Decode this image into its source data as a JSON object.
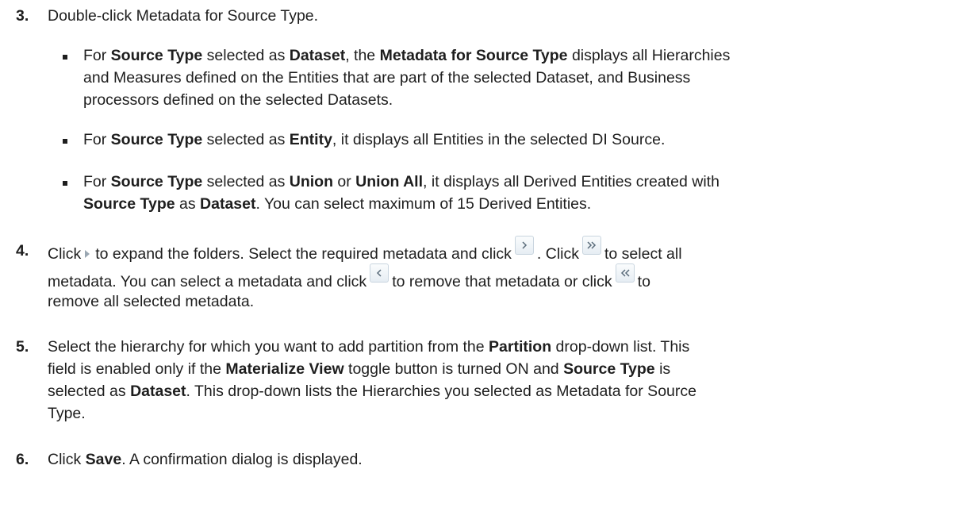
{
  "steps": [
    {
      "number": "3.",
      "text": "Double-click Metadata for Source Type."
    },
    {
      "number": "4.",
      "text_a": "Click",
      "text_b": "to expand the folders. Select the required metadata and click",
      "text_c": ". Click",
      "text_d": "to select all",
      "text_e": "metadata. You can select a metadata and click",
      "text_f": "to remove that metadata or click",
      "text_g": "to",
      "text_h": "remove all selected metadata."
    },
    {
      "number": "5."
    },
    {
      "number": "6."
    }
  ],
  "b1": {
    "a": "For ",
    "b": "Source Type",
    "c": " selected as ",
    "d": "Dataset",
    "e": ", the ",
    "f": "Metadata for Source Type",
    "g": " displays all Hierarchies",
    "h": "and Measures defined on the Entities that are part of the selected Dataset, and Business",
    "i": "processors defined on the selected Datasets."
  },
  "b2": {
    "a": "For ",
    "b": "Source Type",
    "c": " selected as ",
    "d": "Entity",
    "e": ", it displays all Entities in the selected DI Source."
  },
  "b3": {
    "a": "For ",
    "b": "Source Type",
    "c": " selected as ",
    "d": "Union",
    "e": " or ",
    "f": "Union All",
    "g": ", it displays all Derived Entities created with",
    "h": "Source Type",
    "i": " as ",
    "j": "Dataset",
    "k": ".  You can select maximum of 15 Derived Entities."
  },
  "s5": {
    "a": "Select the hierarchy for which you want to add partition from the ",
    "b": "Partition",
    "c": " drop-down list. This",
    "d": "field is enabled only if the ",
    "e": "Materialize View",
    "f": " toggle button is turned ON and ",
    "g": "Source Type",
    "h": " is",
    "i": "selected as ",
    "j": "Dataset",
    "k": ". This drop-down lists the Hierarchies you selected as Metadata for Source",
    "l": "Type."
  },
  "s6": {
    "a": "Click ",
    "b": "Save",
    "c": ". A confirmation dialog is displayed."
  },
  "icons": [
    "expand-triangle-icon",
    "move-right-icon",
    "move-all-right-icon",
    "move-left-icon",
    "move-all-left-icon"
  ],
  "colors": {
    "text": "#1e1e1e",
    "icon_border": "#c9d5df",
    "icon_glyph": "#5a6b7a"
  }
}
